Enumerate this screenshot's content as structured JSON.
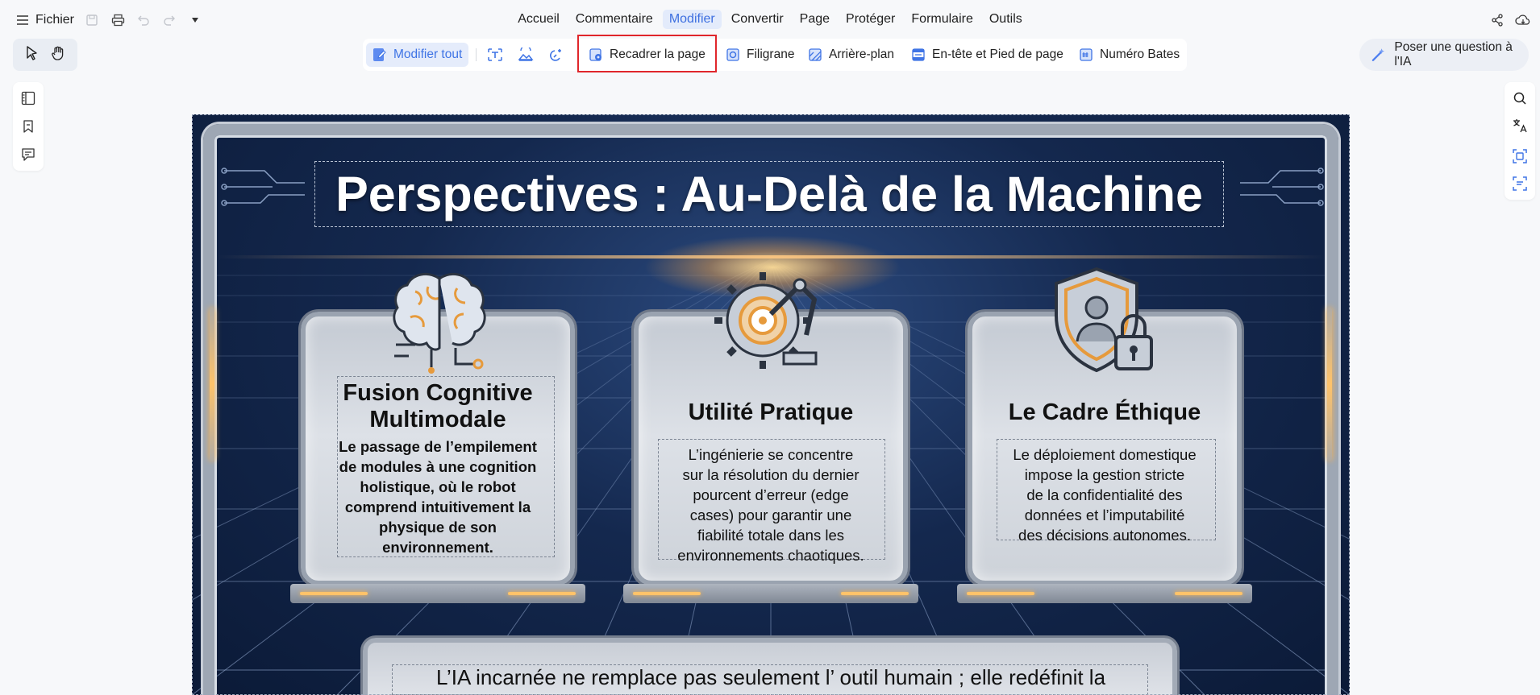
{
  "menubar": {
    "file_label": "Fichier",
    "menus": [
      "Accueil",
      "Commentaire",
      "Modifier",
      "Convertir",
      "Page",
      "Protéger",
      "Formulaire",
      "Outils"
    ],
    "active_menu": "Modifier"
  },
  "toolbar": {
    "edit_all": "Modifier tout",
    "crop_page": "Recadrer la page",
    "watermark": "Filigrane",
    "background": "Arrière-plan",
    "header_footer": "En-tête et Pied de page",
    "bates": "Numéro Bates",
    "ask_ai": "Poser une question à l'IA"
  },
  "document": {
    "title": "Perspectives : Au-Delà de la Machine",
    "cards": [
      {
        "title_line1": "Fusion Cognitive",
        "title_line2": "Multimodale",
        "text_lines": [
          "Le passage de l’empilement",
          "de modules à une cognition",
          "holistique, où le robot",
          "comprend intuitivement la",
          "physique de son",
          "environnement."
        ]
      },
      {
        "title_line1": "Utilité Pratique",
        "text_lines": [
          "L’ingénierie se concentre",
          "sur la résolution du dernier",
          "pourcent d’erreur (edge",
          "cases) pour garantir une",
          "fiabilité totale dans les",
          "environnements chaotiques."
        ]
      },
      {
        "title_line1": "Le Cadre Éthique",
        "text_lines": [
          "Le déploiement domestique",
          "impose la gestion stricte",
          "de la confidentialité des",
          "données et l’imputabilité",
          "des décisions autonomes."
        ]
      }
    ],
    "bottom_text": "L’IA incarnée ne remplace pas seulement l’ outil humain ; elle redéfinit la"
  },
  "colors": {
    "accent": "#3f74e5",
    "highlight_border": "#e0262b",
    "page_bg": "#14284e",
    "glow": "#ffc36a"
  }
}
